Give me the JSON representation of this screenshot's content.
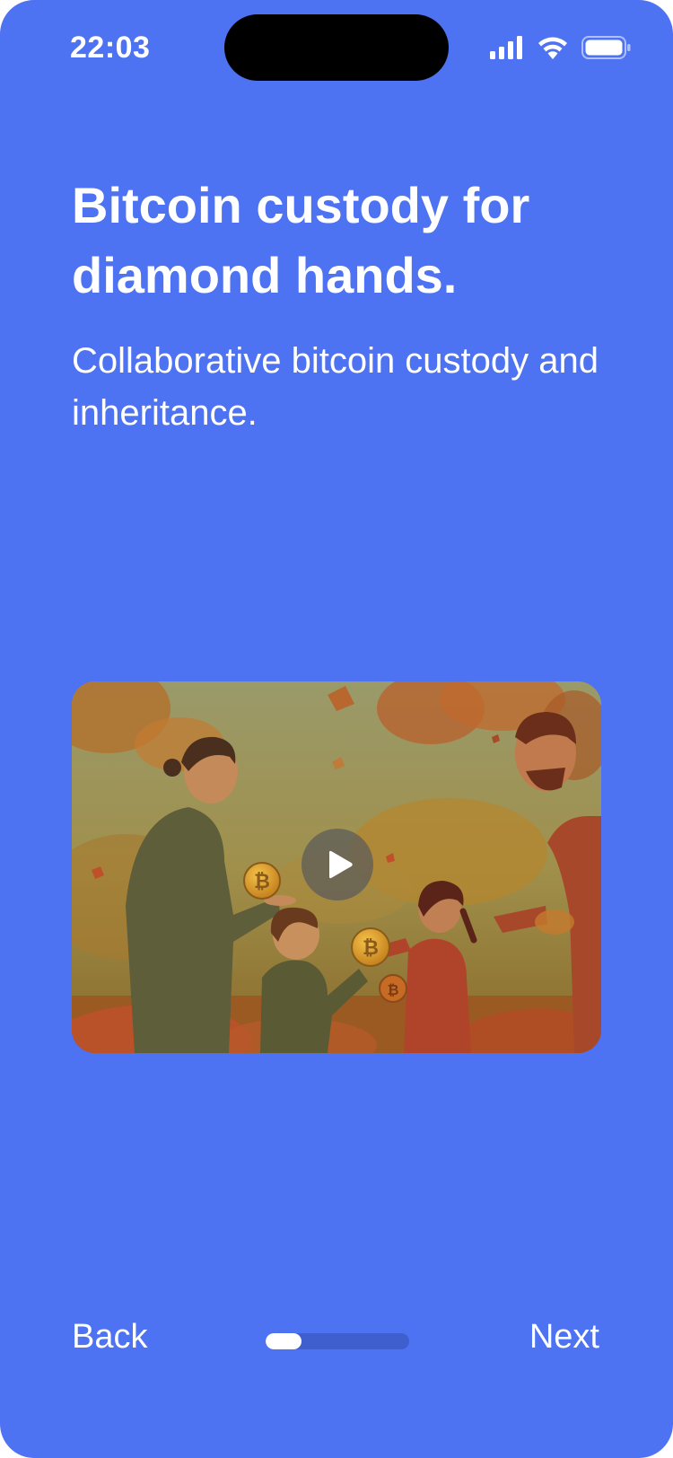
{
  "status_bar": {
    "time": "22:03",
    "icons": [
      "signal-icon",
      "wifi-icon",
      "battery-icon"
    ]
  },
  "onboarding": {
    "headline": "Bitcoin custody for diamond hands.",
    "subhead": "Collaborative bitcoin custody and inheritance.",
    "video": {
      "play_icon": "play-icon"
    }
  },
  "nav": {
    "back_label": "Back",
    "next_label": "Next",
    "progress": 0.25
  },
  "colors": {
    "background": "#4d72f2",
    "text": "#ffffff",
    "progress_track": "#3f5fcf",
    "progress_fill": "#ffffff"
  }
}
